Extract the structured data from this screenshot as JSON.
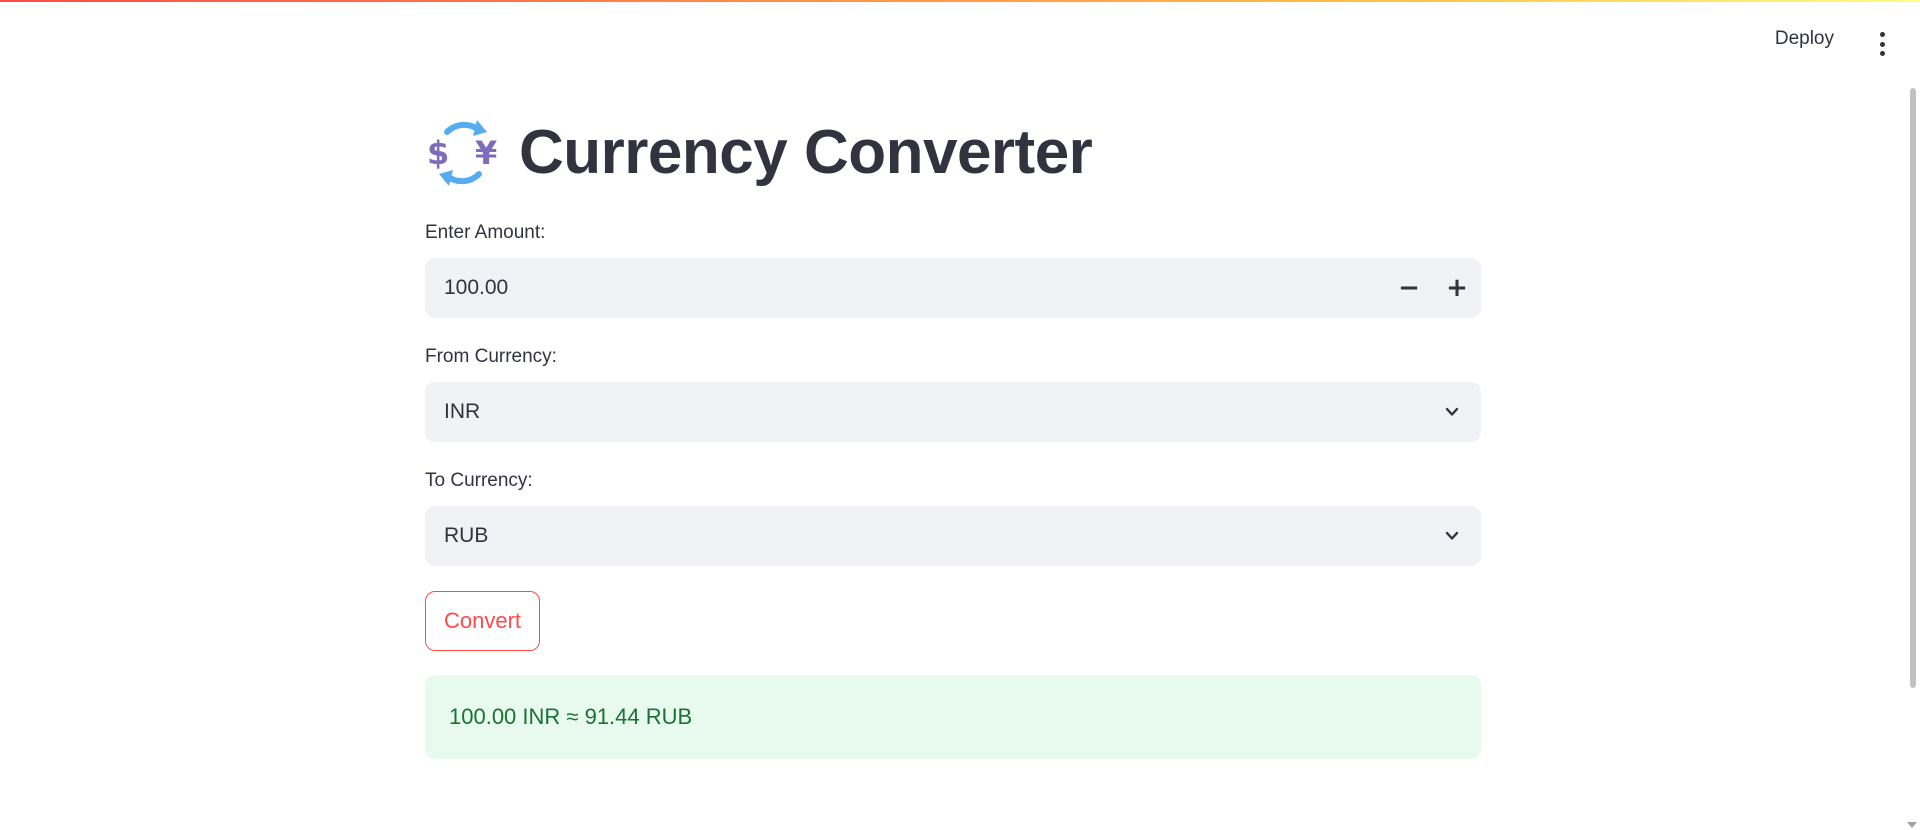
{
  "app": {
    "deploy_label": "Deploy",
    "menu_icon": "vertical-ellipsis-icon"
  },
  "page": {
    "title": "Currency Converter",
    "title_icon": "currency-exchange-icon"
  },
  "amount": {
    "label": "Enter Amount:",
    "value": "100.00",
    "decrement_label": "−",
    "increment_label": "+"
  },
  "from_currency": {
    "label": "From Currency:",
    "value": "INR"
  },
  "to_currency": {
    "label": "To Currency:",
    "value": "RUB"
  },
  "convert_button": {
    "label": "Convert"
  },
  "result": {
    "text": "100.00 INR ≈ 91.44 RUB"
  },
  "colors": {
    "accent": "#ff4b4b",
    "input_bg": "#f0f2f6",
    "success_bg": "#e8f9ee",
    "success_text": "#177233",
    "text": "#31333f"
  }
}
